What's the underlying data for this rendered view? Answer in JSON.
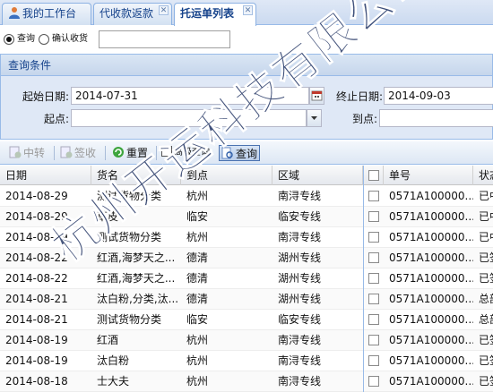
{
  "tabs": [
    {
      "label": "我的工作台",
      "active": false,
      "closable": false
    },
    {
      "label": "代收款返款",
      "active": false,
      "closable": true
    },
    {
      "label": "托运单列表",
      "active": true,
      "closable": true
    }
  ],
  "mode": {
    "option1": "查询",
    "option2": "确认收货",
    "selected": "查询",
    "value": ""
  },
  "query": {
    "title": "查询条件",
    "start_label": "起始日期:",
    "start_value": "2014-07-31",
    "end_label": "终止日期:",
    "end_value": "2014-09-03",
    "from_label": "起点:",
    "from_value": "",
    "to_label": "到点:",
    "to_value": ""
  },
  "toolbar": {
    "transfer": "中转",
    "sign": "签收",
    "reset": "重置",
    "advanced": "高级查询",
    "search": "查询"
  },
  "grid": {
    "left_columns": [
      "日期",
      "货名",
      "到点",
      "区域"
    ],
    "right_columns": [
      "",
      "单号",
      "状态"
    ],
    "rows": [
      {
        "date": "2014-08-29",
        "goods": "测试货物分类",
        "dest": "杭州",
        "region": "南浔专线",
        "no": "0571A100000...",
        "status": "已中"
      },
      {
        "date": "2014-08-29",
        "goods": "草皮",
        "dest": "临安",
        "region": "临安专线",
        "no": "0571A100000...",
        "status": "已中"
      },
      {
        "date": "2014-08-29",
        "goods": "测试货物分类",
        "dest": "杭州",
        "region": "南浔专线",
        "no": "0571A100000...",
        "status": "已中"
      },
      {
        "date": "2014-08-22",
        "goods": "红酒,海梦天之...",
        "dest": "德清",
        "region": "湖州专线",
        "no": "0571A100000...",
        "status": "已签"
      },
      {
        "date": "2014-08-22",
        "goods": "红酒,海梦天之...",
        "dest": "德清",
        "region": "湖州专线",
        "no": "0571A100000...",
        "status": "已签"
      },
      {
        "date": "2014-08-21",
        "goods": "汰白粉,分类,汰...",
        "dest": "德清",
        "region": "湖州专线",
        "no": "0571A100000...",
        "status": "总部"
      },
      {
        "date": "2014-08-21",
        "goods": "测试货物分类",
        "dest": "临安",
        "region": "临安专线",
        "no": "0571A100000...",
        "status": "总部"
      },
      {
        "date": "2014-08-19",
        "goods": "红酒",
        "dest": "杭州",
        "region": "南浔专线",
        "no": "0571A100000...",
        "status": "已签"
      },
      {
        "date": "2014-08-19",
        "goods": "汰白粉",
        "dest": "杭州",
        "region": "南浔专线",
        "no": "0571A100000...",
        "status": "已签"
      },
      {
        "date": "2014-08-18",
        "goods": "士大夫",
        "dest": "杭州",
        "region": "南浔专线",
        "no": "0571A100000...",
        "status": "已签"
      }
    ]
  },
  "watermark": "杭州开运科技有限公司",
  "colors": {
    "panel_bg": "#dfe8f6",
    "border": "#99bbe8",
    "title_text": "#15428b"
  }
}
